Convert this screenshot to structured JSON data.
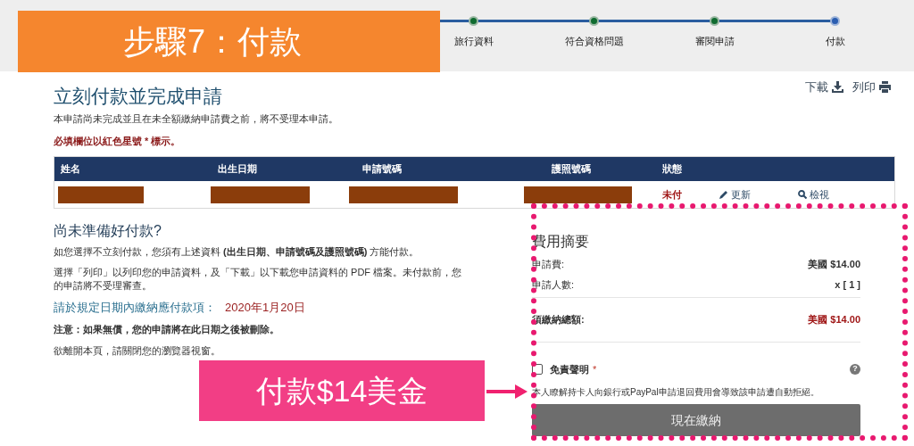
{
  "progress_steps": [
    {
      "label": "旅行資料",
      "selected": false
    },
    {
      "label": "符合資格問題",
      "selected": false
    },
    {
      "label": "審閱申請",
      "selected": false
    },
    {
      "label": "付款",
      "selected": true
    }
  ],
  "actions": [
    {
      "label": "下載",
      "kind": "download"
    },
    {
      "label": "列印",
      "kind": "print"
    }
  ],
  "title": "立刻付款並完成申請",
  "intro": "本申請尚未完成並且在未全額繳納申請費之前，將不受理本申請。",
  "required_note": "必填欄位以紅色星號 * 標示。",
  "table": {
    "columns": [
      "姓名",
      "出生日期",
      "申請號碼",
      "護照號碼",
      "狀態"
    ],
    "rows": [
      {
        "status": "未付",
        "actions": [
          {
            "label": "更新",
            "kind": "edit"
          },
          {
            "label": "檢視",
            "kind": "view"
          }
        ]
      }
    ]
  },
  "not_ready": {
    "heading": "尚未準備好付款?",
    "paragraphs": [
      "如您選擇不立刻付款，您須有上述資料 **(出生日期、申請號碼及護照號碼)** 方能付款。",
      "選擇「列印」以列印您的申請資料，及「下載」以下載您申請資料的 PDF 檔案。未付款前，您的申請將不受理審查。"
    ],
    "due_label": "請於規定日期內繳納應付款項：",
    "due_date": "2020年1月20日",
    "warning": "注意：如果無償，您的申請將在此日期之後被刪除。",
    "leave_note": "欲離開本頁，請關閉您的瀏覽器視窗。"
  },
  "fee_summary": {
    "heading": "費用摘要",
    "lines": [
      {
        "label": "申請費:",
        "value": "美國 $14.00",
        "kind": "plain"
      },
      {
        "label": "申請人數:",
        "value": "x [ 1 ]",
        "kind": "plain"
      },
      {
        "label": "須繳納總額:",
        "value": "美國 $14.00",
        "kind": "total"
      }
    ],
    "disclaimer": {
      "label": "免責聲明",
      "required_mark": "*",
      "checked": false,
      "help": "?"
    },
    "disclaimer_text": "本人瞭解持卡人向銀行或PayPal申請退回費用會導致該申請遭自動拒絕。",
    "pay_button": "現在繳納"
  },
  "annotations": [
    {
      "kind": "step",
      "text": "步驟7：付款"
    },
    {
      "kind": "callout",
      "text": "付款$14美金"
    }
  ]
}
